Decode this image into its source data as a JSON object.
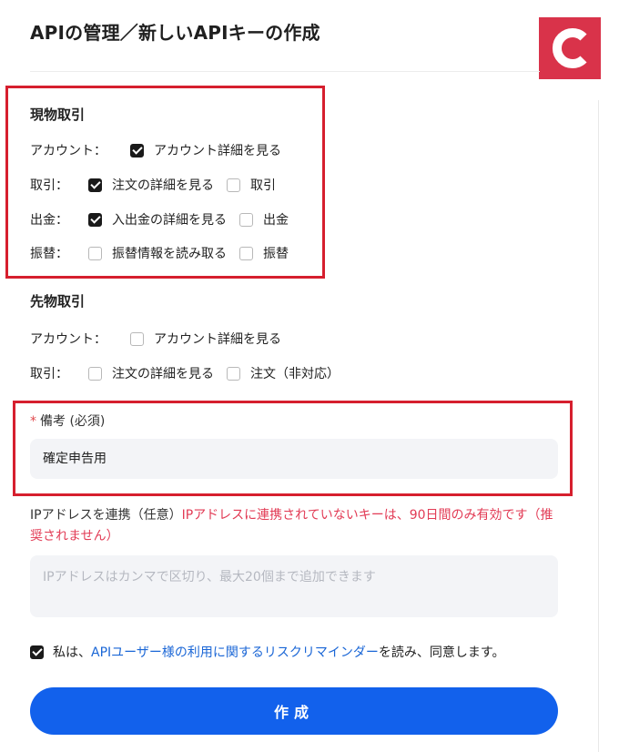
{
  "header": {
    "title": "APIの管理／新しいAPIキーの作成",
    "logo_letter": "C"
  },
  "spot": {
    "title": "現物取引",
    "rows": [
      {
        "label": "アカウント：",
        "options": [
          {
            "label": "アカウント詳細を見る",
            "checked": true
          }
        ]
      },
      {
        "label": "取引：",
        "options": [
          {
            "label": "注文の詳細を見る",
            "checked": true
          },
          {
            "label": "取引",
            "checked": false
          }
        ]
      },
      {
        "label": "出金：",
        "options": [
          {
            "label": "入出金の詳細を見る",
            "checked": true
          },
          {
            "label": "出金",
            "checked": false
          }
        ]
      },
      {
        "label": "振替：",
        "options": [
          {
            "label": "振替情報を読み取る",
            "checked": false
          },
          {
            "label": "振替",
            "checked": false
          }
        ]
      }
    ]
  },
  "futures": {
    "title": "先物取引",
    "rows": [
      {
        "label": "アカウント：",
        "options": [
          {
            "label": "アカウント詳細を見る",
            "checked": false
          }
        ]
      },
      {
        "label": "取引：",
        "options": [
          {
            "label": "注文の詳細を見る",
            "checked": false
          },
          {
            "label": "注文（非対応）",
            "checked": false
          }
        ]
      }
    ]
  },
  "memo": {
    "required_mark": "*",
    "label": "備考 (必須)",
    "value": "確定申告用"
  },
  "ip": {
    "label": "IPアドレスを連携（任意）",
    "warning": "IPアドレスに連携されていないキーは、90日間のみ有効です（推奨されません）",
    "placeholder": "IPアドレスはカンマで区切り、最大20個まで追加できます"
  },
  "agreement": {
    "checked": true,
    "prefix": "私は、",
    "link": "APIユーザー様の利用に関するリスクリマインダー",
    "suffix": "を読み、同意します。"
  },
  "submit_label": "作成",
  "colors": {
    "primary": "#1261ec",
    "highlight": "#d61f2e",
    "warning": "#e23b55",
    "link": "#1a66d6",
    "logo": "#d9334a"
  }
}
